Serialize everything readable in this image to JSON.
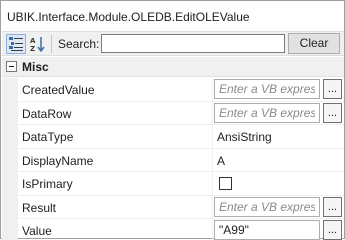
{
  "window": {
    "title": "UBIK.Interface.Module.OLEDB.EditOLEValue"
  },
  "toolbar": {
    "categorized_icon": "categorized-grid-icon",
    "alphabetical_icon": "sort-az-icon",
    "search_label": "Search:",
    "search_value": "",
    "clear_label": "Clear"
  },
  "category": {
    "label": "Misc",
    "expanded": true
  },
  "properties": [
    {
      "name": "CreatedValue",
      "editor": "expression",
      "placeholder": "Enter a VB expressi",
      "value": "",
      "button": "..."
    },
    {
      "name": "DataRow",
      "editor": "expression",
      "placeholder": "Enter a VB expressi",
      "value": "",
      "button": "..."
    },
    {
      "name": "DataType",
      "editor": "text",
      "value": "AnsiString"
    },
    {
      "name": "DisplayName",
      "editor": "text",
      "value": "A"
    },
    {
      "name": "IsPrimary",
      "editor": "checkbox",
      "checked": false
    },
    {
      "name": "Result",
      "editor": "expression",
      "placeholder": "Enter a VB expressi",
      "value": "",
      "button": "..."
    },
    {
      "name": "Value",
      "editor": "expression",
      "placeholder": "Enter a VB expressi",
      "value": "\"A99\"",
      "button": "..."
    }
  ],
  "colors": {
    "toolbar_bg": "#f0f0f0",
    "selected_toolbar_button": "#dde9f6",
    "grid_line": "#f0f0f0"
  }
}
